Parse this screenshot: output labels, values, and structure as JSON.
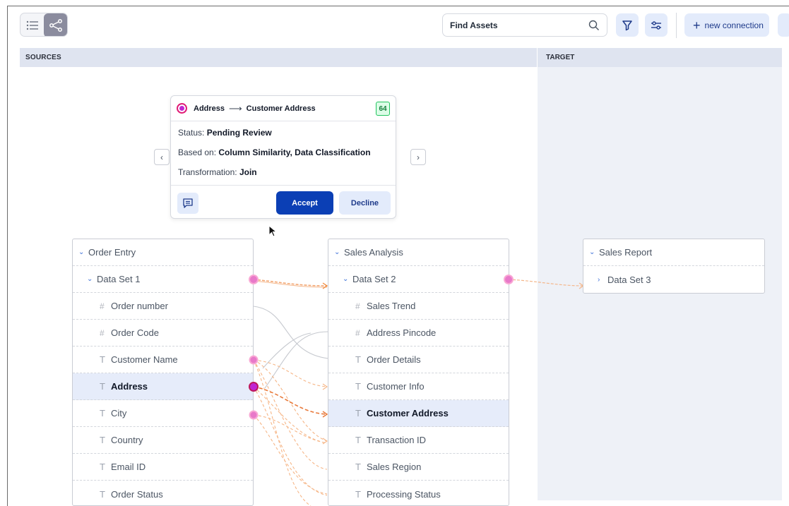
{
  "toolbar": {
    "search": {
      "placeholder": "Find Assets",
      "value": ""
    },
    "new_connection_label": "new connection"
  },
  "columns": {
    "sources": "SOURCES",
    "target": "TARGET"
  },
  "suggestion": {
    "source_field": "Address",
    "target_field": "Customer Address",
    "score": "64",
    "status_label": "Status:",
    "status_value": "Pending Review",
    "based_on_label": "Based on:",
    "based_on_value": "Column Similarity, Data Classification",
    "transformation_label": "Transformation:",
    "transformation_value": "Join",
    "accept_label": "Accept",
    "decline_label": "Decline"
  },
  "order_entry": {
    "title": "Order Entry",
    "dataset": "Data Set 1",
    "fields": [
      {
        "type": "#",
        "name": "Order number"
      },
      {
        "type": "#",
        "name": "Order Code"
      },
      {
        "type": "T",
        "name": "Customer Name"
      },
      {
        "type": "T",
        "name": "Address"
      },
      {
        "type": "T",
        "name": "City"
      },
      {
        "type": "T",
        "name": "Country"
      },
      {
        "type": "T",
        "name": "Email ID"
      },
      {
        "type": "T",
        "name": "Order Status"
      }
    ]
  },
  "sales_analysis": {
    "title": "Sales Analysis",
    "dataset": "Data Set 2",
    "fields": [
      {
        "type": "#",
        "name": "Sales Trend"
      },
      {
        "type": "#",
        "name": "Address Pincode"
      },
      {
        "type": "T",
        "name": "Order Details"
      },
      {
        "type": "T",
        "name": "Customer Info"
      },
      {
        "type": "T",
        "name": "Customer Address"
      },
      {
        "type": "T",
        "name": "Transaction ID"
      },
      {
        "type": "T",
        "name": "Sales Region"
      },
      {
        "type": "T",
        "name": "Processing Status"
      }
    ]
  },
  "sales_report": {
    "title": "Sales Report",
    "dataset": "Data Set 3"
  },
  "colors": {
    "accent": "#0b3fb5",
    "link": "#f08a3c",
    "node": "#c026d3",
    "header_bg": "#dfe4f0",
    "selected_row": "#e6ecfa"
  }
}
